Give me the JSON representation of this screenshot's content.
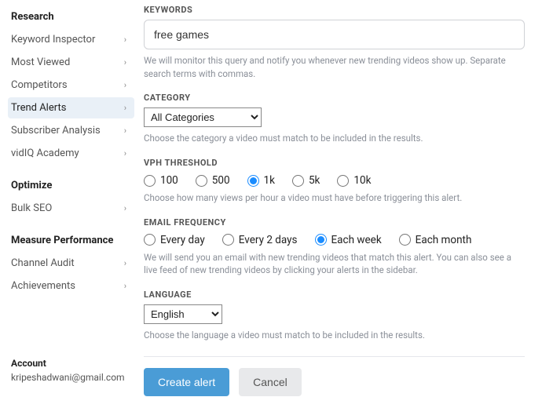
{
  "sidebar": {
    "sections": [
      {
        "title": "Research",
        "items": [
          {
            "label": "Keyword Inspector",
            "active": false
          },
          {
            "label": "Most Viewed",
            "active": false
          },
          {
            "label": "Competitors",
            "active": false
          },
          {
            "label": "Trend Alerts",
            "active": true
          },
          {
            "label": "Subscriber Analysis",
            "active": false
          },
          {
            "label": "vidIQ Academy",
            "active": false
          }
        ]
      },
      {
        "title": "Optimize",
        "items": [
          {
            "label": "Bulk SEO",
            "active": false
          }
        ]
      },
      {
        "title": "Measure Performance",
        "items": [
          {
            "label": "Channel Audit",
            "active": false
          },
          {
            "label": "Achievements",
            "active": false
          }
        ]
      }
    ],
    "account": {
      "label": "Account",
      "email": "kripeshadwani@gmail.com"
    }
  },
  "form": {
    "keywords": {
      "label": "KEYWORDS",
      "value": "free games",
      "helper": "We will monitor this query and notify you whenever new trending videos show up. Separate search terms with commas."
    },
    "category": {
      "label": "CATEGORY",
      "selected": "All Categories",
      "helper": "Choose the category a video must match to be included in the results."
    },
    "vph": {
      "label": "VPH THRESHOLD",
      "options": [
        "100",
        "500",
        "1k",
        "5k",
        "10k"
      ],
      "selected": "1k",
      "helper": "Choose how many views per hour a video must have before triggering this alert."
    },
    "email_freq": {
      "label": "EMAIL FREQUENCY",
      "options": [
        "Every day",
        "Every 2 days",
        "Each week",
        "Each month"
      ],
      "selected": "Each week",
      "helper": "We will send you an email with new trending videos that match this alert. You can also see a live feed of new trending videos by clicking your alerts in the sidebar."
    },
    "language": {
      "label": "LANGUAGE",
      "selected": "English",
      "helper": "Choose the language a video must match to be included in the results."
    },
    "actions": {
      "create": "Create alert",
      "cancel": "Cancel"
    }
  }
}
